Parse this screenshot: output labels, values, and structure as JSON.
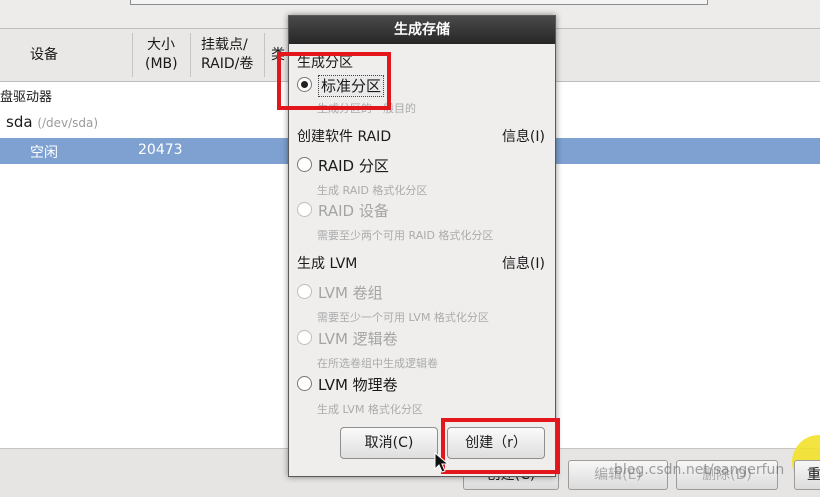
{
  "table": {
    "headers": {
      "device": "设备",
      "size_line1": "大小",
      "size_line2": "(MB)",
      "mount_line1": "挂载点/",
      "mount_line2": "RAID/卷",
      "type_partial": "类"
    },
    "rows": {
      "drives_label": "盘驱动器",
      "sda_name": "sda",
      "sda_path": "(/dev/sda)",
      "free_label": "空闲",
      "free_size": "20473"
    }
  },
  "bottom_buttons": {
    "create": "创建(C)",
    "edit": "编辑(E)",
    "delete": "删除(D)",
    "reset_partial": "重"
  },
  "watermark": "blog.csdn.net/sangerfun",
  "dialog": {
    "title": "生成存储",
    "section_partition": "生成分区",
    "standard_partition": "标准分区",
    "standard_partition_desc": "生成分区的一般目的",
    "section_raid": "创建软件 RAID",
    "info_raid": "信息(I)",
    "raid_partition": "RAID 分区",
    "raid_partition_desc": "生成 RAID 格式化分区",
    "raid_device": "RAID 设备",
    "raid_device_desc": "需要至少两个可用 RAID 格式化分区",
    "section_lvm": "生成 LVM",
    "info_lvm": "信息(I)",
    "lvm_vg": "LVM 卷组",
    "lvm_vg_desc": "需要至少一个可用 LVM 格式化分区",
    "lvm_lv": "LVM 逻辑卷",
    "lvm_lv_desc": "在所选卷组中生成逻辑卷",
    "lvm_pv": "LVM 物理卷",
    "lvm_pv_desc": "生成 LVM 格式化分区",
    "cancel": "取消(C)",
    "create": "创建（r）"
  },
  "colors": {
    "highlight": "#e3171b",
    "selection": "#7ea1d1",
    "annotation_dot": "#f3e12b"
  }
}
